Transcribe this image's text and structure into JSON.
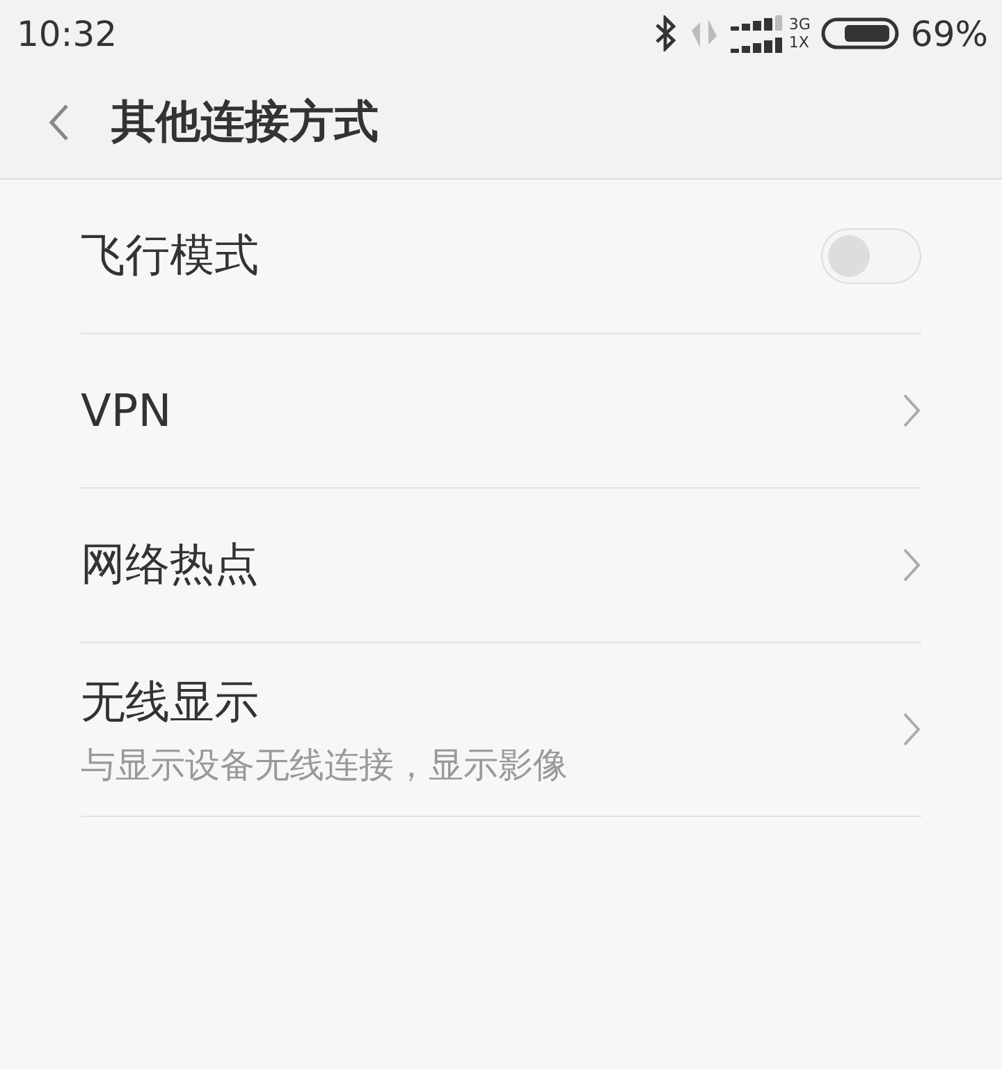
{
  "status_bar": {
    "time": "10:32",
    "network_top": "3G",
    "network_bottom": "1X",
    "battery": "69%"
  },
  "header": {
    "title": "其他连接方式"
  },
  "items": [
    {
      "kind": "toggle",
      "label": "飞行模式",
      "on": false
    },
    {
      "kind": "link",
      "label": "VPN"
    },
    {
      "kind": "link",
      "label": "网络热点"
    },
    {
      "kind": "link",
      "label": "无线显示",
      "subtitle": "与显示设备无线连接，显示影像"
    }
  ]
}
